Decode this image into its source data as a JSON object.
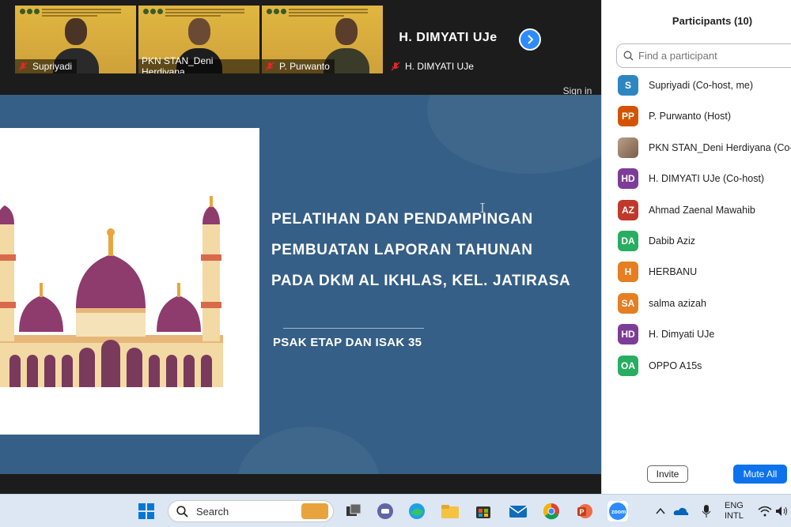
{
  "video_strip": {
    "tiles": [
      {
        "name": "Supriyadi",
        "muted": true
      },
      {
        "name": "PKN STAN_Deni Herdiyana",
        "muted": false
      },
      {
        "name": "P. Purwanto",
        "muted": true
      },
      {
        "name": "H. DIMYATI UJe",
        "big_name": "H. DIMYATI UJe",
        "muted": true
      }
    ],
    "sign_in": "Sign in"
  },
  "slide": {
    "title_lines": [
      "PELATIHAN DAN PENDAMPINGAN",
      "PEMBUATAN LAPORAN TAHUNAN",
      "PADA DKM AL IKHLAS, KEL. JATIRASA"
    ],
    "subtitle": "PSAK ETAP DAN ISAK 35"
  },
  "participants": {
    "title": "Participants (10)",
    "search_placeholder": "Find a participant",
    "list": [
      {
        "initials": "S",
        "name": "Supriyadi (Co-host, me)",
        "color": "#2e86c1"
      },
      {
        "initials": "PP",
        "name": "P. Purwanto (Host)",
        "color": "#d35400"
      },
      {
        "initials": "",
        "name": "PKN STAN_Deni Herdiyana (Co-h",
        "color": "photo"
      },
      {
        "initials": "HD",
        "name": "H. DIMYATI UJe (Co-host)",
        "color": "#7d3c98"
      },
      {
        "initials": "AZ",
        "name": "Ahmad Zaenal Mawahib",
        "color": "#c0392b"
      },
      {
        "initials": "DA",
        "name": "Dabib Aziz",
        "color": "#27ae60"
      },
      {
        "initials": "H",
        "name": "HERBANU",
        "color": "#e67e22"
      },
      {
        "initials": "SA",
        "name": "salma azizah",
        "color": "#e67e22"
      },
      {
        "initials": "HD",
        "name": "H. Dimyati UJe",
        "color": "#7d3c98"
      },
      {
        "initials": "OA",
        "name": "OPPO A15s",
        "color": "#27ae60"
      }
    ],
    "invite_label": "Invite",
    "mute_all_label": "Mute All"
  },
  "taskbar": {
    "search_label": "Search",
    "lang_line1": "ENG",
    "lang_line2": "INTL",
    "apps": [
      "start-icon",
      "briefcase-icon",
      "task-view-icon",
      "chat-icon",
      "edge-icon",
      "file-explorer-icon",
      "store-icon",
      "mail-icon",
      "chrome-icon",
      "powerpoint-icon",
      "zoom-icon"
    ],
    "accent": "#0e72ed"
  }
}
